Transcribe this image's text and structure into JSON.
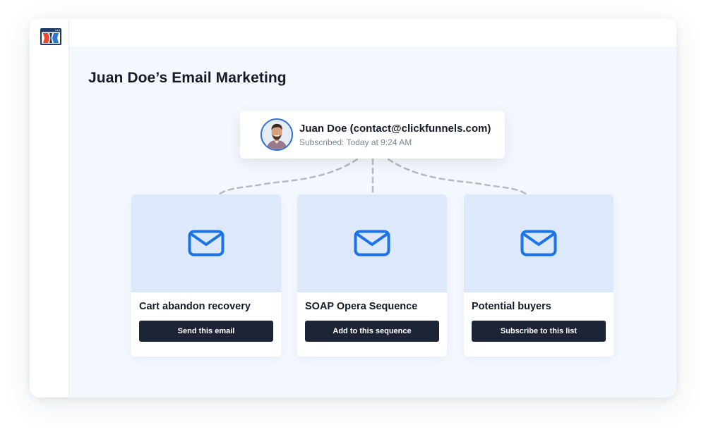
{
  "page": {
    "title": "Juan Doe’s Email Marketing"
  },
  "contact": {
    "name_line": "Juan Doe (contact@clickfunnels.com)",
    "subscribed_line": "Subscribed: Today at 9:24 AM"
  },
  "actions": [
    {
      "title": "Cart abandon recovery",
      "button_label": "Send this email",
      "icon": "envelope-icon"
    },
    {
      "title": "SOAP Opera Sequence",
      "button_label": "Add to this sequence",
      "icon": "envelope-icon"
    },
    {
      "title": "Potential buyers",
      "button_label": "Subscribe to this list",
      "icon": "envelope-icon"
    }
  ],
  "icons": {
    "logo": "clickfunnels-logo-icon",
    "avatar": "user-avatar",
    "card_icon": "envelope-icon"
  },
  "colors": {
    "accent": "#1a73e8",
    "button_bg": "#1c2436",
    "card_top_bg": "#dde9fb",
    "main_bg": "#f3f8fe",
    "connector": "#b5b9c0",
    "avatar_ring": "#2f6fd6"
  }
}
